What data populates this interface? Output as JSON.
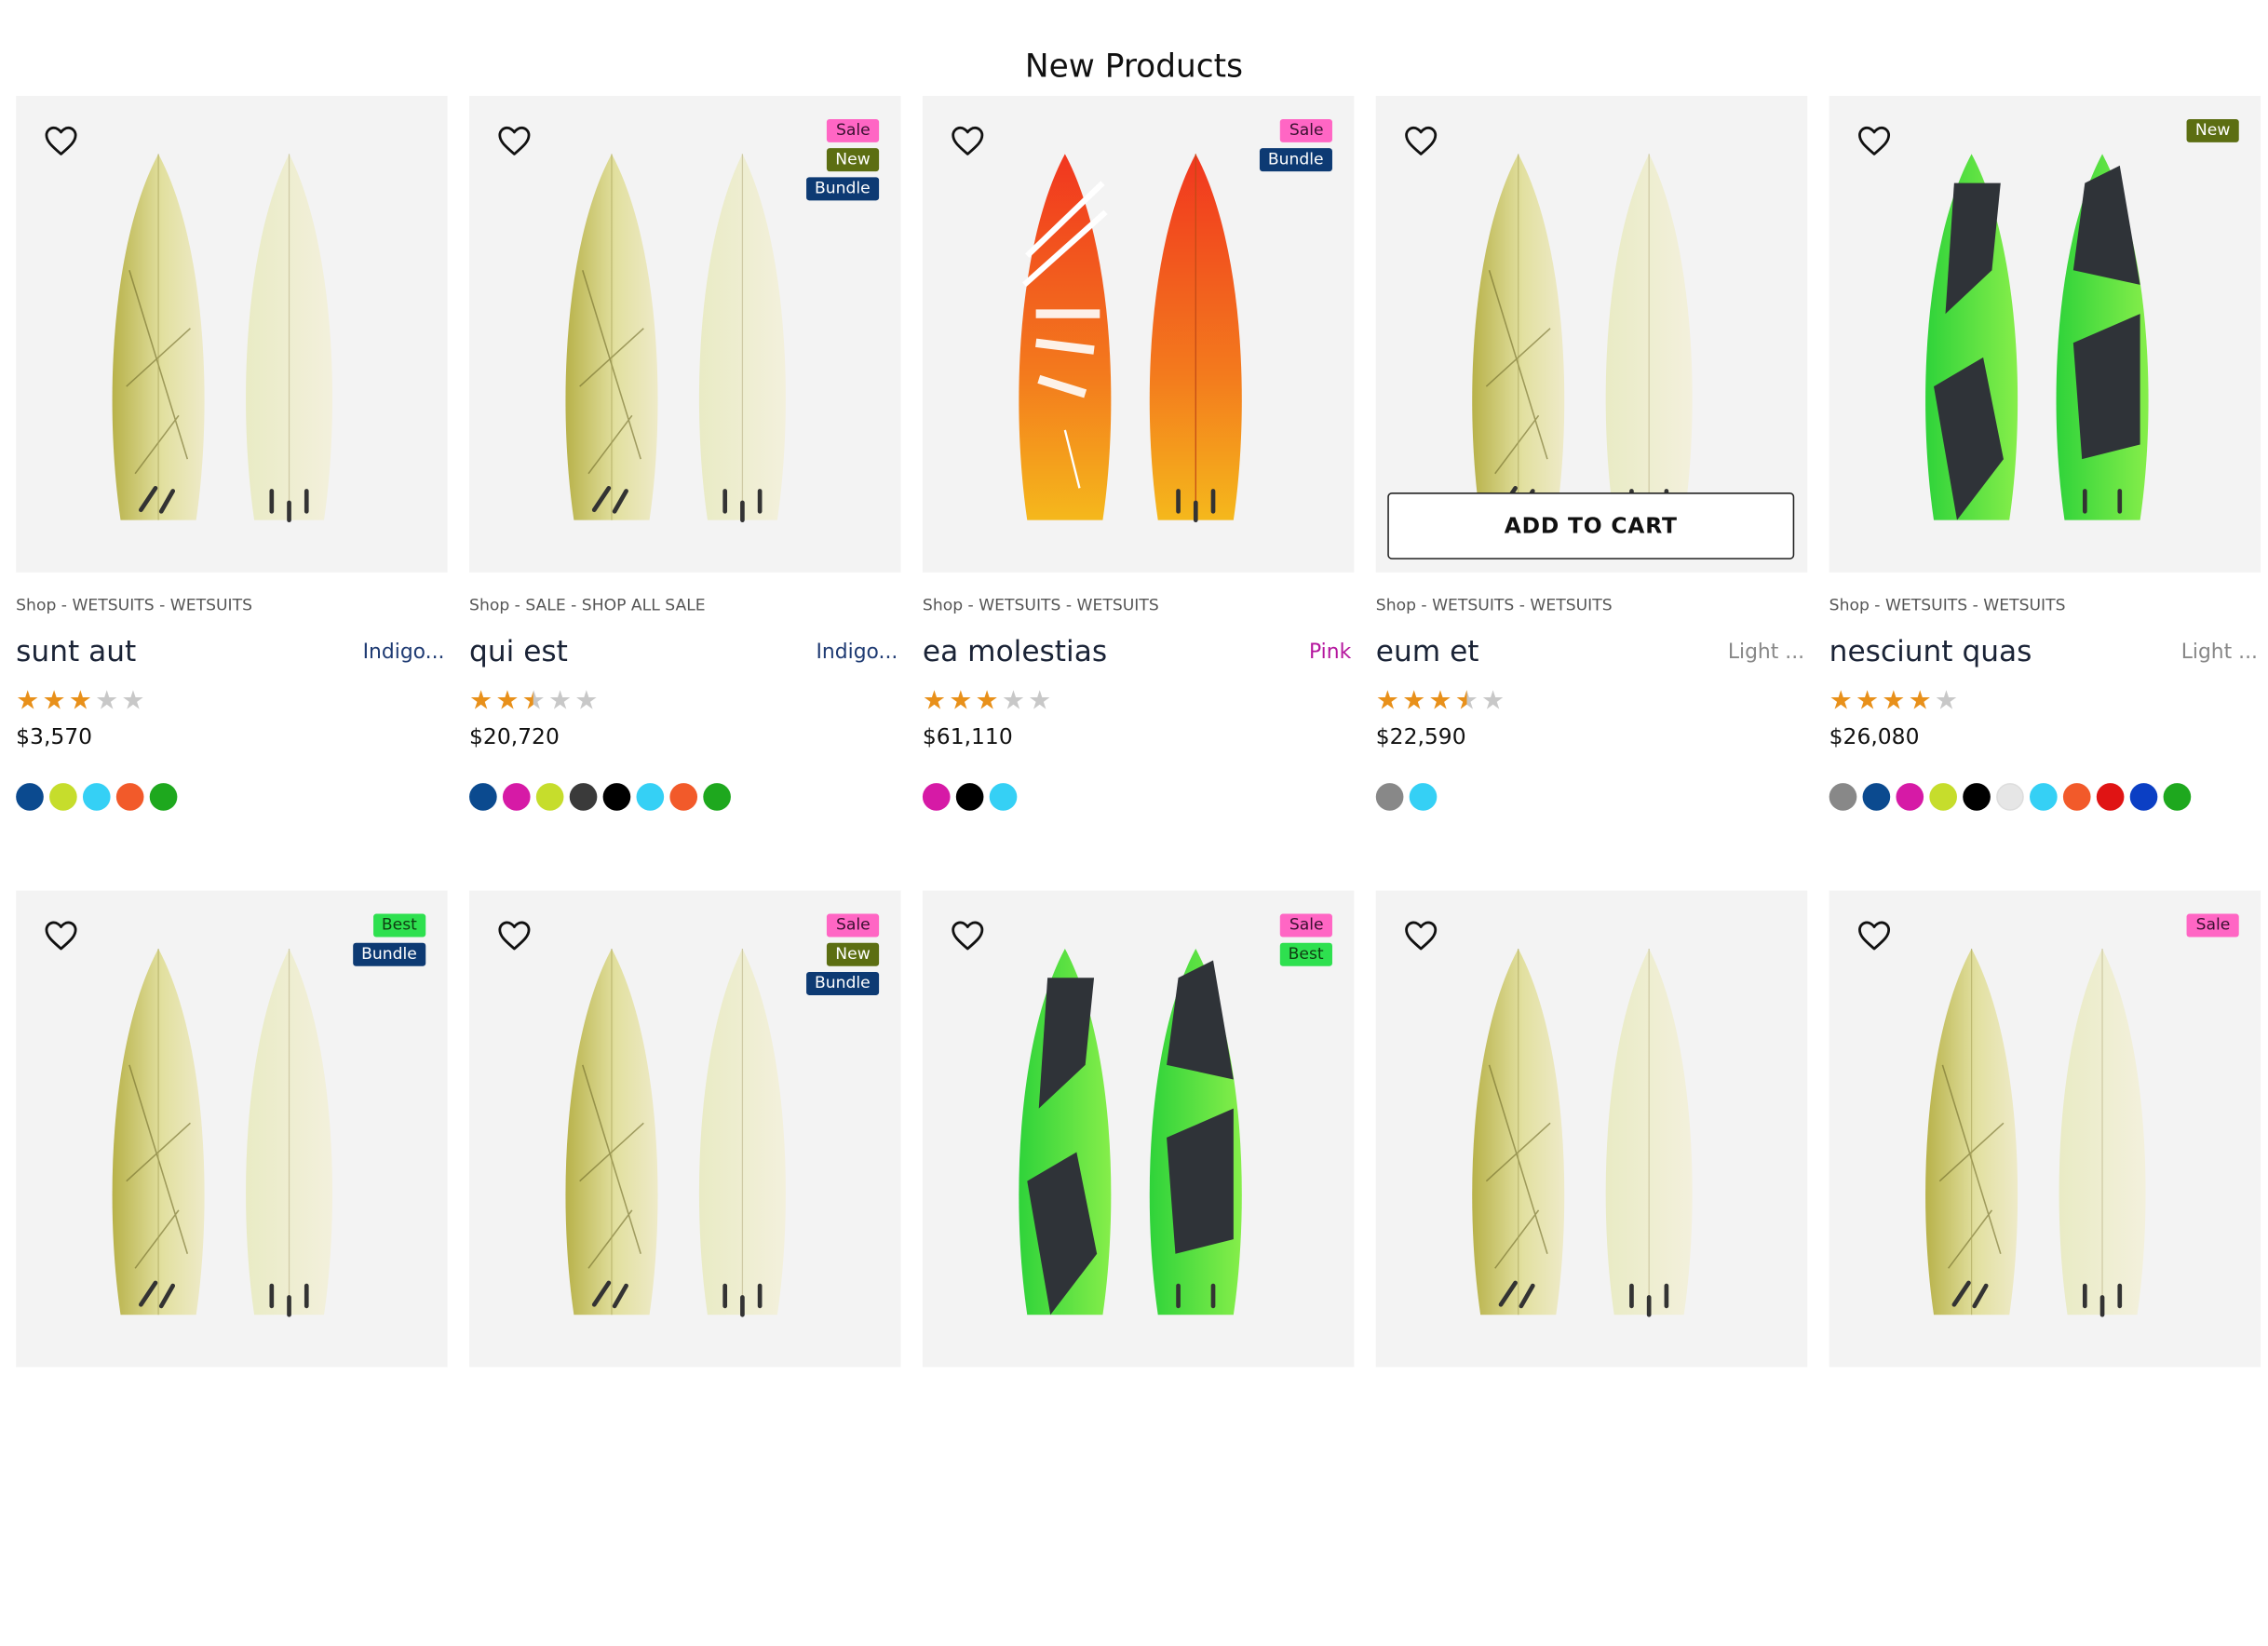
{
  "section": {
    "title": "New Products"
  },
  "ui": {
    "add_to_cart": "ADD TO CART"
  },
  "colors": {
    "star_filled": "#e8901a",
    "star_empty": "#c8c8c8",
    "badge_sale_bg": "#ff66c4",
    "badge_new_bg": "#5c6e12",
    "badge_bundle_bg": "#0d3a73",
    "badge_best_bg": "#2ee04f"
  },
  "products": [
    {
      "category": "Shop - WETSUITS - WETSUITS",
      "name": "sunt aut",
      "color_label": "Indigo...",
      "color_label_hex": "#1f3b73",
      "rating": 3,
      "price": "$3,570",
      "board_style": "leaf",
      "badges": [],
      "show_add_to_cart": false,
      "swatches": [
        "#0b4a8f",
        "#c6dd2c",
        "#35d0f5",
        "#f25a2a",
        "#1ea81e"
      ]
    },
    {
      "category": "Shop - SALE - SHOP ALL SALE",
      "name": "qui est",
      "color_label": "Indigo...",
      "color_label_hex": "#1f3b73",
      "rating": 2.5,
      "price": "$20,720",
      "board_style": "leaf",
      "badges": [
        "Sale",
        "New",
        "Bundle"
      ],
      "show_add_to_cart": false,
      "swatches": [
        "#0b4a8f",
        "#d61aa6",
        "#c6dd2c",
        "#3a3a3a",
        "#000000",
        "#35d0f5",
        "#f25a2a",
        "#1ea81e"
      ]
    },
    {
      "category": "Shop - WETSUITS - WETSUITS",
      "name": "ea molestias",
      "color_label": "Pink",
      "color_label_hex": "#b5179e",
      "rating": 3,
      "price": "$61,110",
      "board_style": "orange",
      "badges": [
        "Sale",
        "Bundle"
      ],
      "show_add_to_cart": false,
      "swatches": [
        "#d61aa6",
        "#000000",
        "#35d0f5"
      ]
    },
    {
      "category": "Shop - WETSUITS - WETSUITS",
      "name": "eum et",
      "color_label": "Light ...",
      "color_label_hex": "#888888",
      "rating": 3.5,
      "price": "$22,590",
      "board_style": "leaf",
      "badges": [],
      "show_add_to_cart": true,
      "swatches": [
        "#888888",
        "#35d0f5"
      ]
    },
    {
      "category": "Shop - WETSUITS - WETSUITS",
      "name": "nesciunt quas",
      "color_label": "Light ...",
      "color_label_hex": "#888888",
      "rating": 4,
      "price": "$26,080",
      "board_style": "green",
      "badges": [
        "New"
      ],
      "show_add_to_cart": false,
      "swatches": [
        "#888888",
        "#0b4a8f",
        "#d61aa6",
        "#c6dd2c",
        "#000000",
        "#e6e6e6",
        "#35d0f5",
        "#f25a2a",
        "#e01414",
        "#0b3fc4",
        "#1ea81e"
      ]
    },
    {
      "board_style": "leaf",
      "badges": [
        "Best",
        "Bundle"
      ],
      "show_add_to_cart": false
    },
    {
      "board_style": "leaf",
      "badges": [
        "Sale",
        "New",
        "Bundle"
      ],
      "show_add_to_cart": false
    },
    {
      "board_style": "green",
      "badges": [
        "Sale",
        "Best"
      ],
      "show_add_to_cart": false
    },
    {
      "board_style": "leaf",
      "badges": [],
      "show_add_to_cart": false
    },
    {
      "board_style": "leaf",
      "badges": [
        "Sale"
      ],
      "show_add_to_cart": false
    }
  ]
}
